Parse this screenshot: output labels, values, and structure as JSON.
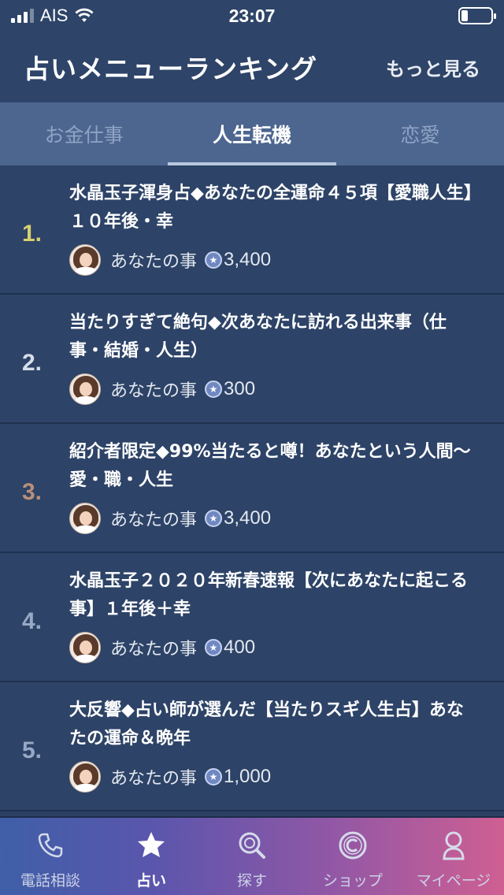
{
  "status_bar": {
    "carrier": "AIS",
    "time": "23:07"
  },
  "header": {
    "title": "占いメニューランキング",
    "more_link": "もっと見る"
  },
  "tabs": [
    {
      "label": "お金仕事",
      "active": false
    },
    {
      "label": "人生転機",
      "active": true
    },
    {
      "label": "恋愛",
      "active": false
    }
  ],
  "items": [
    {
      "rank": "1.",
      "rank_color": "#d8cf6e",
      "title": "水晶玉子渾身占◆あなたの全運命４５項【愛職人生】１０年後・幸",
      "author": "あなたの事",
      "price": "3,400"
    },
    {
      "rank": "2.",
      "rank_color": "#d7dde8",
      "title": "当たりすぎて絶句◆次あなたに訪れる出来事（仕事・結婚・人生）",
      "author": "あなたの事",
      "price": "300"
    },
    {
      "rank": "3.",
      "rank_color": "#b8907a",
      "title": "紹介者限定◆99%当たると噂！あなたという人間〜愛・職・人生",
      "author": "あなたの事",
      "price": "3,400"
    },
    {
      "rank": "4.",
      "rank_color": "#97a9c6",
      "title": "水晶玉子２０２０年新春速報【次にあなたに起こる事】１年後＋幸",
      "author": "あなたの事",
      "price": "400"
    },
    {
      "rank": "5.",
      "rank_color": "#97a9c6",
      "title": "大反響◆占い師が選んだ【当たりスギ人生占】あなたの運命＆晩年",
      "author": "あなたの事",
      "price": "1,000"
    }
  ],
  "tabbar": [
    {
      "label": "電話相談",
      "icon": "phone-icon",
      "active": false
    },
    {
      "label": "占い",
      "icon": "star-icon",
      "active": true
    },
    {
      "label": "探す",
      "icon": "search-icon",
      "active": false
    },
    {
      "label": "ショップ",
      "icon": "coin-icon",
      "active": false
    },
    {
      "label": "マイページ",
      "icon": "person-icon",
      "active": false
    }
  ],
  "colors": {
    "background": "#2b4163",
    "header": "#2e4468",
    "tabs": "#4d6690"
  }
}
